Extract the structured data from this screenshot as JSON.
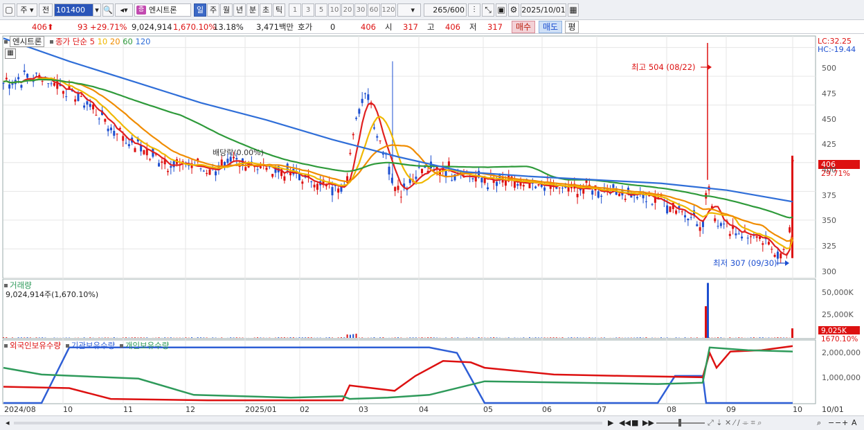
{
  "toolbar": {
    "period_type": "주",
    "prev_label": "전",
    "stock_code": "101400",
    "stock_tag": "증",
    "stock_name": "엔시트론",
    "timeframes": [
      "일",
      "주",
      "월",
      "년",
      "분",
      "초",
      "틱"
    ],
    "active_timeframe": "일",
    "intervals": [
      "1",
      "3",
      "5",
      "10",
      "20",
      "30",
      "60",
      "120"
    ],
    "count_value": "265",
    "count_total": "/600",
    "date": "2025/10/01"
  },
  "quote": {
    "price": "406",
    "arrow": "⬆",
    "change": "93",
    "change_pct": "+29.71%",
    "volume": "9,024,914",
    "volume_ratio": "1,670.10%",
    "turnover": "13.18%",
    "amount": "3,471백만",
    "hoga_label": "호가",
    "hoga_value": "0",
    "current": "406",
    "open_label": "시",
    "open": "317",
    "high_label": "고",
    "high": "406",
    "low_label": "저",
    "low": "317",
    "buy_label": "매수",
    "sell_label": "매도",
    "eval_label": "평"
  },
  "price_panel": {
    "stock_label": "엔시트론",
    "ma_title": "종가 단순",
    "ma_periods": [
      "5",
      "10",
      "20",
      "60",
      "120"
    ],
    "ma_colors": [
      "#e02020",
      "#f0b800",
      "#f08c00",
      "#2e9a3a",
      "#2f6ed8"
    ],
    "lc": "LC:32.25",
    "hc": "HC:-19.44",
    "y_ticks": [
      "500",
      "475",
      "450",
      "425",
      "400",
      "375",
      "350",
      "325",
      "300"
    ],
    "current_badge": "406",
    "current_pct": "29.71%",
    "high_annotation": "최고 504 (08/22)",
    "low_annotation": "최저 307 (09/30)",
    "dividend_annotation": "배당락(0.00%)"
  },
  "volume_panel": {
    "title": "거래량",
    "value": "9,024,914주(1,670.10%)",
    "y_ticks": [
      "50,000K",
      "25,000K"
    ],
    "current_badge": "9,025K",
    "current_pct": "1670.10%"
  },
  "holdings_panel": {
    "series": [
      {
        "name": "외국인보유수량",
        "color": "#d11"
      },
      {
        "name": "기관보유수량",
        "color": "#2f5fd6"
      },
      {
        "name": "개인보유수량",
        "color": "#2e9a5a"
      }
    ],
    "y_ticks": [
      "2,000,000",
      "1,000,000"
    ]
  },
  "x_axis": {
    "labels": [
      "2024/08",
      "10",
      "11",
      "12",
      "2025/01",
      "02",
      "03",
      "04",
      "05",
      "06",
      "07",
      "08",
      "09",
      "10",
      "10/01"
    ]
  },
  "chart_data": {
    "type": "line",
    "price_ylim": [
      300,
      510
    ],
    "annotations": {
      "high": 504,
      "low": 307,
      "last": 406
    },
    "ma120": [
      508,
      488,
      470,
      452,
      437,
      420,
      405,
      392,
      388,
      385,
      382,
      376,
      366
    ],
    "volume_ylim": [
      0,
      55000
    ],
    "holdings_ylim": [
      0,
      2300000
    ]
  }
}
